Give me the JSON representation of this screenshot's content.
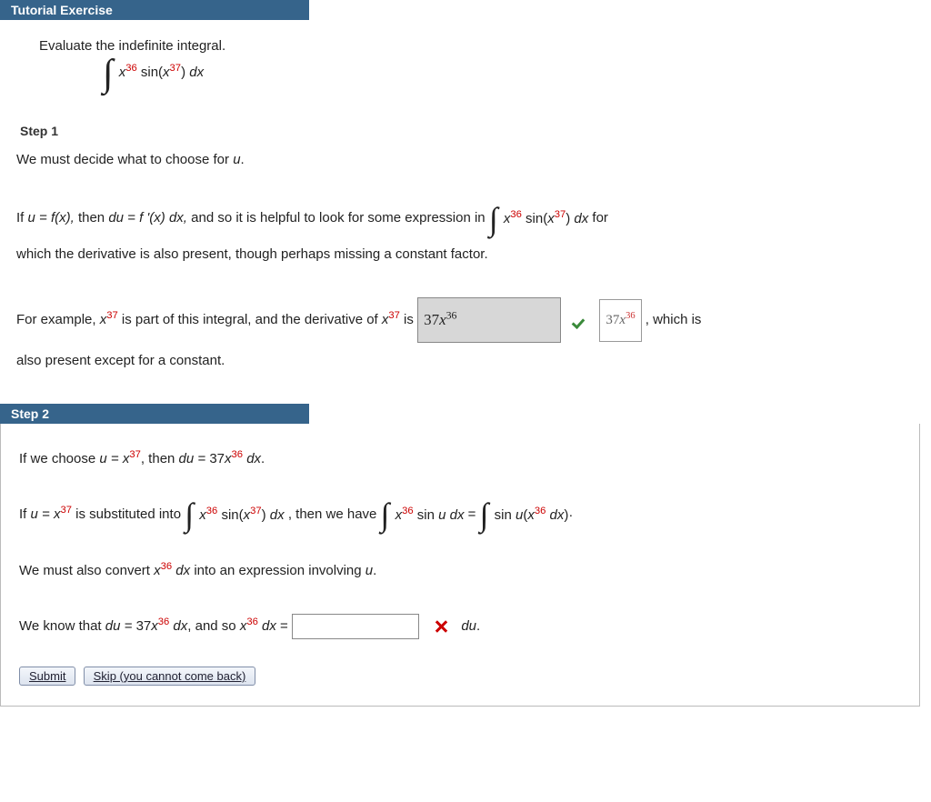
{
  "header": {
    "title": "Tutorial Exercise"
  },
  "prompt": "Evaluate the indefinite integral.",
  "integral": {
    "x_base": "x",
    "x_sup": "36",
    "fn": "sin(",
    "arg_base": "x",
    "arg_sup": "37",
    "close": ") ",
    "dx": "dx"
  },
  "step1": {
    "label": "Step 1",
    "line1": "We must decide what to choose for ",
    "u": "u",
    "period": ".",
    "if_text_1": "If  ",
    "eq1": "u = f(x),",
    "then": "  then  ",
    "eq2": "du = f '(x) dx,",
    "tail_2": "  and so it is helpful to look for some expression in ",
    "for": "  for",
    "line3": "which the derivative is also present, though perhaps missing a constant factor.",
    "ex_1": "For example,  ",
    "x37_base": "x",
    "x37_sup": "37",
    "ex_2": "  is part of this integral, and the derivative of  ",
    "is": "  is ",
    "answer_user": {
      "coef": "37",
      "base": "x",
      "sup": "36"
    },
    "answer_correct": {
      "coef": "37",
      "base": "x",
      "sup": "36"
    },
    "ex_tail": ", which is",
    "ex_line2": "also present except for a constant."
  },
  "step2": {
    "label": "Step 2",
    "l1_a": "If we choose  ",
    "l1_b": "u = x",
    "l1_b_sup": "37",
    "l1_c": ",  then  ",
    "l1_d": "du = ",
    "l1_coef": "37",
    "l1_base": "x",
    "l1_sup": "36",
    "l1_dx": " dx",
    "l1_e": ".",
    "l2_a": "If  ",
    "l2_b": "u = x",
    "l2_b_sup": "37",
    "l2_c": "  is substituted into ",
    "l2_d": ",  then we have ",
    "l2_sinu": " sin ",
    "l2_u": "u",
    "l2_dxm": " dx",
    "l2_eq": "  = ",
    "l2_rhs1": " sin ",
    "l2_rhs_u": "u",
    "l2_rhs_open": "(",
    "l2_rhs_base": "x",
    "l2_rhs_sup": "36",
    "l2_rhs_dx": " dx",
    "l2_rhs_close": ")",
    "l2_dot": "·",
    "l3": "We must also convert  ",
    "l3_base": "x",
    "l3_sup": "36",
    "l3_dx": " dx",
    "l3_tail": "  into an expression involving ",
    "l3_u": "u",
    "l3_end": ".",
    "l4_a": "We know that  ",
    "l4_b": "du = ",
    "l4_coef": "37",
    "l4_base": "x",
    "l4_sup": "36",
    "l4_dx": " dx",
    "l4_c": ",  and so  ",
    "l4_d_base": "x",
    "l4_d_sup": "36",
    "l4_d_dx": " dx",
    "l4_eq": "  =  ",
    "l4_du": "du",
    "l4_end": "."
  },
  "buttons": {
    "submit": "Submit",
    "skip": "Skip (you cannot come back)"
  }
}
